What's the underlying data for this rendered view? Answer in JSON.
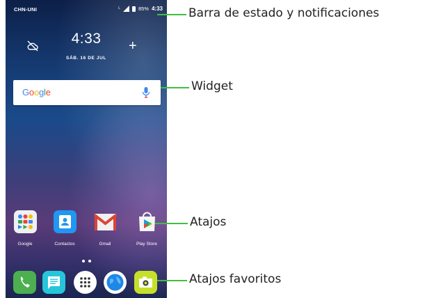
{
  "status_bar": {
    "carrier": "CHN-UNI",
    "network_type": "L",
    "battery": "85%",
    "time": "4:33"
  },
  "clock_widget": {
    "time": "4:33",
    "date": "SÁB. 16 DE JUL",
    "add_label": "+"
  },
  "search_widget": {
    "logo_text": "Google",
    "logo_letters": [
      "G",
      "o",
      "o",
      "g",
      "l",
      "e"
    ],
    "logo_colors": [
      "#4285F4",
      "#EA4335",
      "#FBBC05",
      "#4285F4",
      "#34A853",
      "#EA4335"
    ]
  },
  "shortcuts": [
    {
      "label": "Google",
      "icon": "google-folder-icon"
    },
    {
      "label": "Contactos",
      "icon": "contacts-icon"
    },
    {
      "label": "Gmail",
      "icon": "gmail-icon"
    },
    {
      "label": "Play Store",
      "icon": "play-store-icon"
    }
  ],
  "dock": [
    {
      "icon": "phone-icon",
      "color": "#4caf50"
    },
    {
      "icon": "messages-icon",
      "color": "#26c6da"
    },
    {
      "icon": "app-drawer-icon",
      "color": "#ffffff"
    },
    {
      "icon": "browser-icon",
      "color": "#1e88e5"
    },
    {
      "icon": "camera-icon",
      "color": "#c6e02a"
    }
  ],
  "callouts": {
    "status_bar": "Barra de estado y notificaciones",
    "widget": "Widget",
    "shortcuts": "Atajos",
    "favorites": "Atajos favoritos"
  },
  "colors": {
    "callout_line": "#3fbf3f",
    "wallpaper_top": "#0c1f48",
    "wallpaper_mid": "#5a3b78"
  }
}
